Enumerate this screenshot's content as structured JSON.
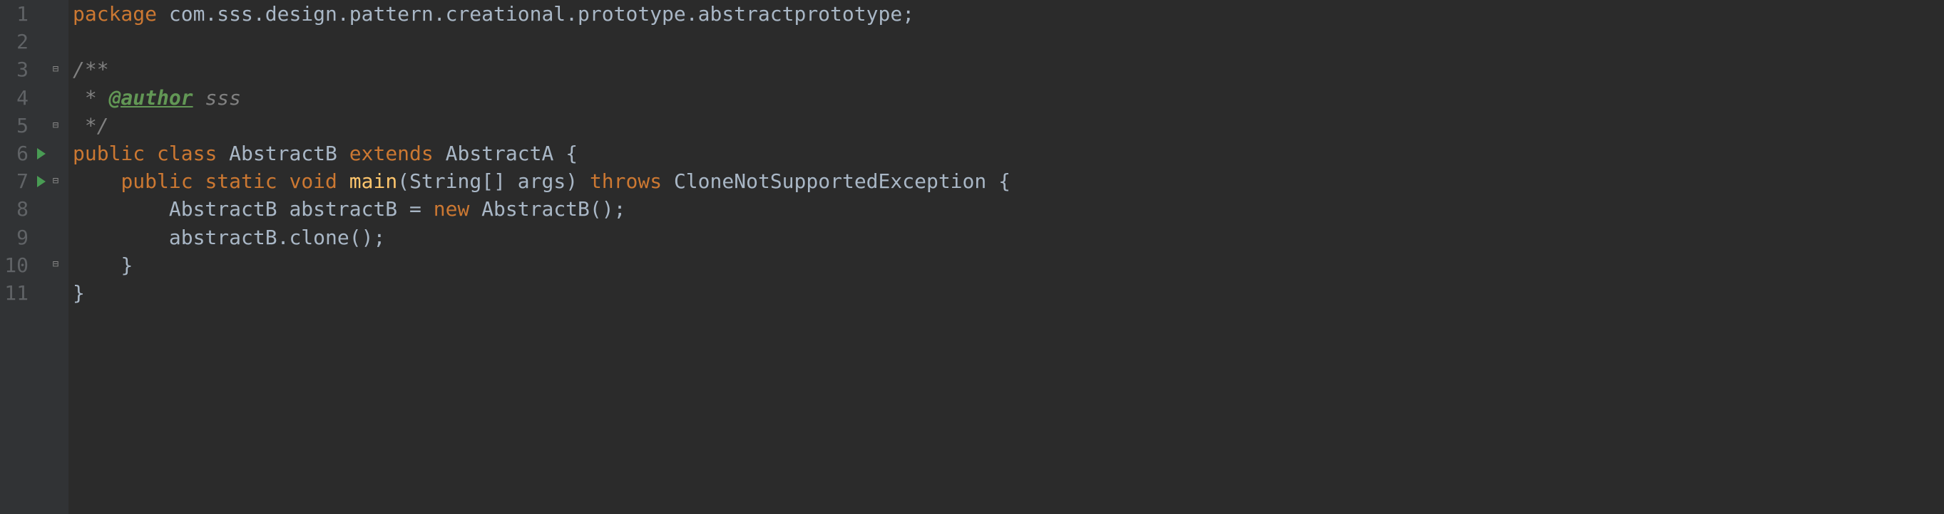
{
  "lines": {
    "l1": "1",
    "l2": "2",
    "l3": "3",
    "l4": "4",
    "l5": "5",
    "l6": "6",
    "l7": "7",
    "l8": "8",
    "l9": "9",
    "l10": "10",
    "l11": "11"
  },
  "code": {
    "package_kw": "package",
    "package_name": " com.sss.design.pattern.creational.prototype.abstractprototype",
    "semicolon": ";",
    "doc_start": "/**",
    "doc_star": " * ",
    "doc_author_tag": "@author",
    "doc_author_val": " sss",
    "doc_end": " */",
    "public_kw": "public",
    "class_kw": "class",
    "static_kw": "static",
    "void_kw": "void",
    "extends_kw": "extends",
    "throws_kw": "throws",
    "new_kw": "new",
    "classB": "AbstractB",
    "classA": "AbstractA",
    "main": "main",
    "stringarr": "String[]",
    "args": "args",
    "exc": "CloneNotSupportedException",
    "varname": "abstractB",
    "clone": "clone",
    "lbrace": "{",
    "rbrace": "}",
    "lparen": "(",
    "rparen": ")",
    "eq": " = ",
    "dot": ".",
    "empty_parens": "()",
    "space": " "
  }
}
